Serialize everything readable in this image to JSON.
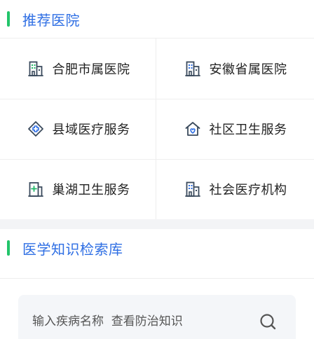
{
  "colors": {
    "accent_bar": "#22c46a",
    "title_blue": "#2f6fe4",
    "icon_dark": "#3a4a5c",
    "icon_green": "#22b86a",
    "icon_blue": "#2f6fe4"
  },
  "recommended": {
    "title": "推荐医院",
    "items": [
      {
        "label": "合肥市属医院",
        "icon": "hospital-building-icon"
      },
      {
        "label": "安徽省属医院",
        "icon": "hospital-building-icon"
      },
      {
        "label": "县域医疗服务",
        "icon": "medical-cross-diamond-icon"
      },
      {
        "label": "社区卫生服务",
        "icon": "community-home-heart-icon"
      },
      {
        "label": "巢湖卫生服务",
        "icon": "clinic-plus-icon"
      },
      {
        "label": "社会医疗机构",
        "icon": "hospital-building-icon"
      }
    ]
  },
  "knowledge": {
    "title": "医学知识检索库",
    "search_placeholder": "输入疾病名称  查看防治知识",
    "search_icon": "search-icon"
  }
}
